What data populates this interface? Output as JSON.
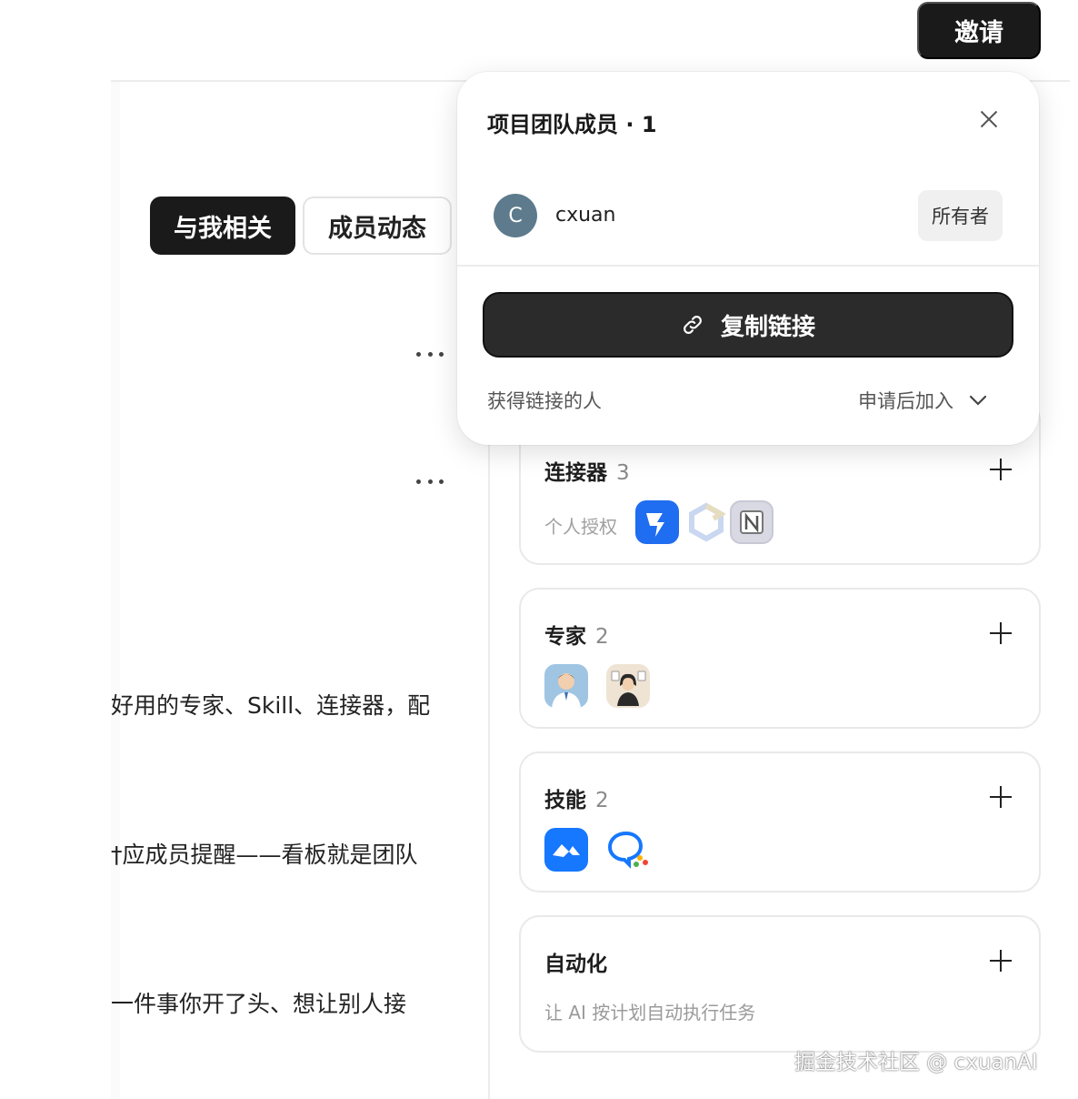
{
  "header": {
    "invite_label": "邀请"
  },
  "tabs": [
    {
      "label": "与我相关",
      "active": true
    },
    {
      "label": "成员动态",
      "active": false
    }
  ],
  "feed": {
    "lines": [
      "好用的专家、Skill、连接器，配",
      "†应成员提醒——看板就是团队",
      "一件事你开了头、想让别人接"
    ]
  },
  "team_popover": {
    "title": "项目团队成员 · 1",
    "member": {
      "initial": "C",
      "name": "cxuan",
      "role": "所有者"
    },
    "copy_link_label": "复制链接",
    "link_access_label": "获得链接的人",
    "link_access_value": "申请后加入"
  },
  "cards": {
    "connectors": {
      "title": "连接器",
      "count": "3",
      "subtitle": "个人授权",
      "icons": [
        "dingtalk-icon",
        "lark-icon",
        "notion-icon"
      ]
    },
    "experts": {
      "title": "专家",
      "count": "2",
      "icons": [
        "doctor-avatar-icon",
        "consultant-avatar-icon"
      ]
    },
    "skills": {
      "title": "技能",
      "count": "2",
      "icons": [
        "tencent-meeting-icon",
        "chat-bubble-icon"
      ]
    },
    "automation": {
      "title": "自动化",
      "subtitle": "让 AI 按计划自动执行任务"
    }
  },
  "watermark": "掘金技术社区 @ cxuanAI",
  "colors": {
    "dark": "#1a1a1a",
    "avatar": "#5d7b8c",
    "border": "#e9e9e9"
  }
}
